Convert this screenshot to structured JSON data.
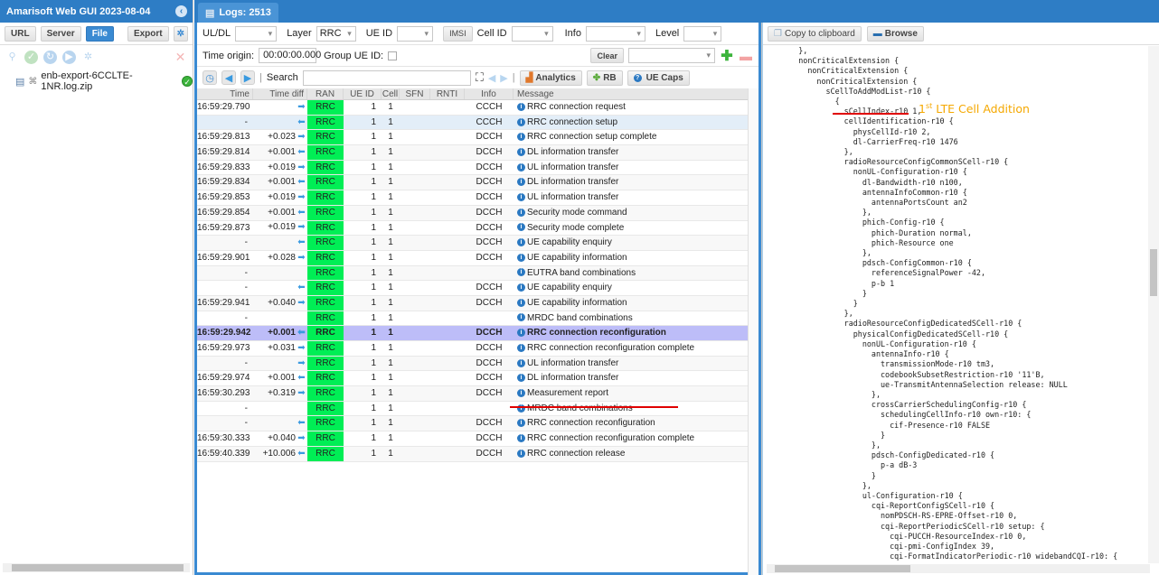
{
  "app": {
    "title": "Amarisoft Web GUI 2023-08-04"
  },
  "left": {
    "toolbar": {
      "url": "URL",
      "server": "Server",
      "file": "File",
      "export": "Export"
    },
    "file": {
      "name": "enb-export-6CCLTE-1NR.log.zip",
      "status": "ok"
    }
  },
  "tab": {
    "label": "Logs: 2513"
  },
  "filters": {
    "uldl_label": "UL/DL",
    "uldl_value": "",
    "layer_label": "Layer",
    "layer_value": "RRC",
    "ueid_label": "UE ID",
    "ueid_value": "",
    "imsi_label": "IMSI",
    "cellid_label": "Cell ID",
    "cellid_value": "",
    "info_label": "Info",
    "info_value": "",
    "level_label": "Level",
    "level_value": "",
    "time_origin_label": "Time origin:",
    "time_origin_value": "00:00:00.000",
    "group_ueid_label": "Group UE ID:",
    "group_ueid_checked": false,
    "clear_label": "Clear",
    "filter_select_value": ""
  },
  "toolbar2": {
    "search_label": "Search",
    "search_value": "",
    "analytics": "Analytics",
    "rb": "RB",
    "ue_caps": "UE Caps"
  },
  "grid": {
    "columns": [
      "Time",
      "Time diff",
      "RAN",
      "UE ID",
      "Cell",
      "SFN",
      "RNTI",
      "Info",
      "Message"
    ],
    "rows": [
      {
        "time": "16:59:29.790",
        "diff": "",
        "dir": "ul",
        "ran": "RRC",
        "ue": "1",
        "cell": "1",
        "sfn": "",
        "rnti": "",
        "info": "CCCH",
        "msg": "RRC connection request"
      },
      {
        "time": "-",
        "diff": "",
        "dir": "dl",
        "ran": "RRC",
        "ue": "1",
        "cell": "1",
        "sfn": "",
        "rnti": "",
        "info": "CCCH",
        "msg": "RRC connection setup",
        "state": "hover"
      },
      {
        "time": "16:59:29.813",
        "diff": "+0.023",
        "dir": "ul",
        "ran": "RRC",
        "ue": "1",
        "cell": "1",
        "sfn": "",
        "rnti": "",
        "info": "DCCH",
        "msg": "RRC connection setup complete"
      },
      {
        "time": "16:59:29.814",
        "diff": "+0.001",
        "dir": "dl",
        "ran": "RRC",
        "ue": "1",
        "cell": "1",
        "sfn": "",
        "rnti": "",
        "info": "DCCH",
        "msg": "DL information transfer"
      },
      {
        "time": "16:59:29.833",
        "diff": "+0.019",
        "dir": "ul",
        "ran": "RRC",
        "ue": "1",
        "cell": "1",
        "sfn": "",
        "rnti": "",
        "info": "DCCH",
        "msg": "UL information transfer"
      },
      {
        "time": "16:59:29.834",
        "diff": "+0.001",
        "dir": "dl",
        "ran": "RRC",
        "ue": "1",
        "cell": "1",
        "sfn": "",
        "rnti": "",
        "info": "DCCH",
        "msg": "DL information transfer"
      },
      {
        "time": "16:59:29.853",
        "diff": "+0.019",
        "dir": "ul",
        "ran": "RRC",
        "ue": "1",
        "cell": "1",
        "sfn": "",
        "rnti": "",
        "info": "DCCH",
        "msg": "UL information transfer"
      },
      {
        "time": "16:59:29.854",
        "diff": "+0.001",
        "dir": "dl",
        "ran": "RRC",
        "ue": "1",
        "cell": "1",
        "sfn": "",
        "rnti": "",
        "info": "DCCH",
        "msg": "Security mode command"
      },
      {
        "time": "16:59:29.873",
        "diff": "+0.019",
        "dir": "ul",
        "ran": "RRC",
        "ue": "1",
        "cell": "1",
        "sfn": "",
        "rnti": "",
        "info": "DCCH",
        "msg": "Security mode complete"
      },
      {
        "time": "-",
        "diff": "",
        "dir": "dl",
        "ran": "RRC",
        "ue": "1",
        "cell": "1",
        "sfn": "",
        "rnti": "",
        "info": "DCCH",
        "msg": "UE capability enquiry"
      },
      {
        "time": "16:59:29.901",
        "diff": "+0.028",
        "dir": "ul",
        "ran": "RRC",
        "ue": "1",
        "cell": "1",
        "sfn": "",
        "rnti": "",
        "info": "DCCH",
        "msg": "UE capability information"
      },
      {
        "time": "-",
        "diff": "",
        "dir": "",
        "ran": "RRC",
        "ue": "1",
        "cell": "1",
        "sfn": "",
        "rnti": "",
        "info": "",
        "msg": "EUTRA band combinations"
      },
      {
        "time": "-",
        "diff": "",
        "dir": "dl",
        "ran": "RRC",
        "ue": "1",
        "cell": "1",
        "sfn": "",
        "rnti": "",
        "info": "DCCH",
        "msg": "UE capability enquiry"
      },
      {
        "time": "16:59:29.941",
        "diff": "+0.040",
        "dir": "ul",
        "ran": "RRC",
        "ue": "1",
        "cell": "1",
        "sfn": "",
        "rnti": "",
        "info": "DCCH",
        "msg": "UE capability information"
      },
      {
        "time": "-",
        "diff": "",
        "dir": "",
        "ran": "RRC",
        "ue": "1",
        "cell": "1",
        "sfn": "",
        "rnti": "",
        "info": "",
        "msg": "MRDC band combinations"
      },
      {
        "time": "16:59:29.942",
        "diff": "+0.001",
        "dir": "dl",
        "ran": "RRC",
        "ue": "1",
        "cell": "1",
        "sfn": "",
        "rnti": "",
        "info": "DCCH",
        "msg": "RRC connection reconfiguration",
        "state": "selected"
      },
      {
        "time": "16:59:29.973",
        "diff": "+0.031",
        "dir": "ul",
        "ran": "RRC",
        "ue": "1",
        "cell": "1",
        "sfn": "",
        "rnti": "",
        "info": "DCCH",
        "msg": "RRC connection reconfiguration complete"
      },
      {
        "time": "-",
        "diff": "",
        "dir": "ul",
        "ran": "RRC",
        "ue": "1",
        "cell": "1",
        "sfn": "",
        "rnti": "",
        "info": "DCCH",
        "msg": "UL information transfer"
      },
      {
        "time": "16:59:29.974",
        "diff": "+0.001",
        "dir": "dl",
        "ran": "RRC",
        "ue": "1",
        "cell": "1",
        "sfn": "",
        "rnti": "",
        "info": "DCCH",
        "msg": "DL information transfer"
      },
      {
        "time": "16:59:30.293",
        "diff": "+0.319",
        "dir": "ul",
        "ran": "RRC",
        "ue": "1",
        "cell": "1",
        "sfn": "",
        "rnti": "",
        "info": "DCCH",
        "msg": "Measurement report"
      },
      {
        "time": "-",
        "diff": "",
        "dir": "",
        "ran": "RRC",
        "ue": "1",
        "cell": "1",
        "sfn": "",
        "rnti": "",
        "info": "",
        "msg": "MRDC band combinations"
      },
      {
        "time": "-",
        "diff": "",
        "dir": "dl",
        "ran": "RRC",
        "ue": "1",
        "cell": "1",
        "sfn": "",
        "rnti": "",
        "info": "DCCH",
        "msg": "RRC connection reconfiguration"
      },
      {
        "time": "16:59:30.333",
        "diff": "+0.040",
        "dir": "ul",
        "ran": "RRC",
        "ue": "1",
        "cell": "1",
        "sfn": "",
        "rnti": "",
        "info": "DCCH",
        "msg": "RRC connection reconfiguration complete"
      },
      {
        "time": "16:59:40.339",
        "diff": "+10.006",
        "dir": "dl",
        "ran": "RRC",
        "ue": "1",
        "cell": "1",
        "sfn": "",
        "rnti": "",
        "info": "DCCH",
        "msg": "RRC connection release"
      }
    ]
  },
  "right": {
    "copy_label": "Copy to clipboard",
    "browse_label": "Browse",
    "annotation": {
      "prefix": "1",
      "sup": "st",
      "text": " LTE Cell Addition"
    },
    "code_lines": [
      "      },",
      "      nonCriticalExtension {",
      "        nonCriticalExtension {",
      "          nonCriticalExtension {",
      "            sCellToAddModList-r10 {",
      "              {",
      "                sCellIndex-r10 1,",
      "                cellIdentification-r10 {",
      "                  physCellId-r10 2,",
      "                  dl-CarrierFreq-r10 1476",
      "                },",
      "                radioResourceConfigCommonSCell-r10 {",
      "                  nonUL-Configuration-r10 {",
      "                    dl-Bandwidth-r10 n100,",
      "                    antennaInfoCommon-r10 {",
      "                      antennaPortsCount an2",
      "                    },",
      "                    phich-Config-r10 {",
      "                      phich-Duration normal,",
      "                      phich-Resource one",
      "                    },",
      "                    pdsch-ConfigCommon-r10 {",
      "                      referenceSignalPower -42,",
      "                      p-b 1",
      "                    }",
      "                  }",
      "                },",
      "                radioResourceConfigDedicatedSCell-r10 {",
      "                  physicalConfigDedicatedSCell-r10 {",
      "                    nonUL-Configuration-r10 {",
      "                      antennaInfo-r10 {",
      "                        transmissionMode-r10 tm3,",
      "                        codebookSubsetRestriction-r10 '11'B,",
      "                        ue-TransmitAntennaSelection release: NULL",
      "                      },",
      "                      crossCarrierSchedulingConfig-r10 {",
      "                        schedulingCellInfo-r10 own-r10: {",
      "                          cif-Presence-r10 FALSE",
      "                        }",
      "                      },",
      "                      pdsch-ConfigDedicated-r10 {",
      "                        p-a dB-3",
      "                      }",
      "                    },",
      "                    ul-Configuration-r10 {",
      "                      cqi-ReportConfigSCell-r10 {",
      "                        nomPDSCH-RS-EPRE-Offset-r10 0,",
      "                        cqi-ReportPeriodicSCell-r10 setup: {",
      "                          cqi-PUCCH-ResourceIndex-r10 0,",
      "                          cqi-pmi-ConfigIndex 39,",
      "                          cqi-FormatIndicatorPeriodic-r10 widebandCQI-r10: {"
    ]
  }
}
